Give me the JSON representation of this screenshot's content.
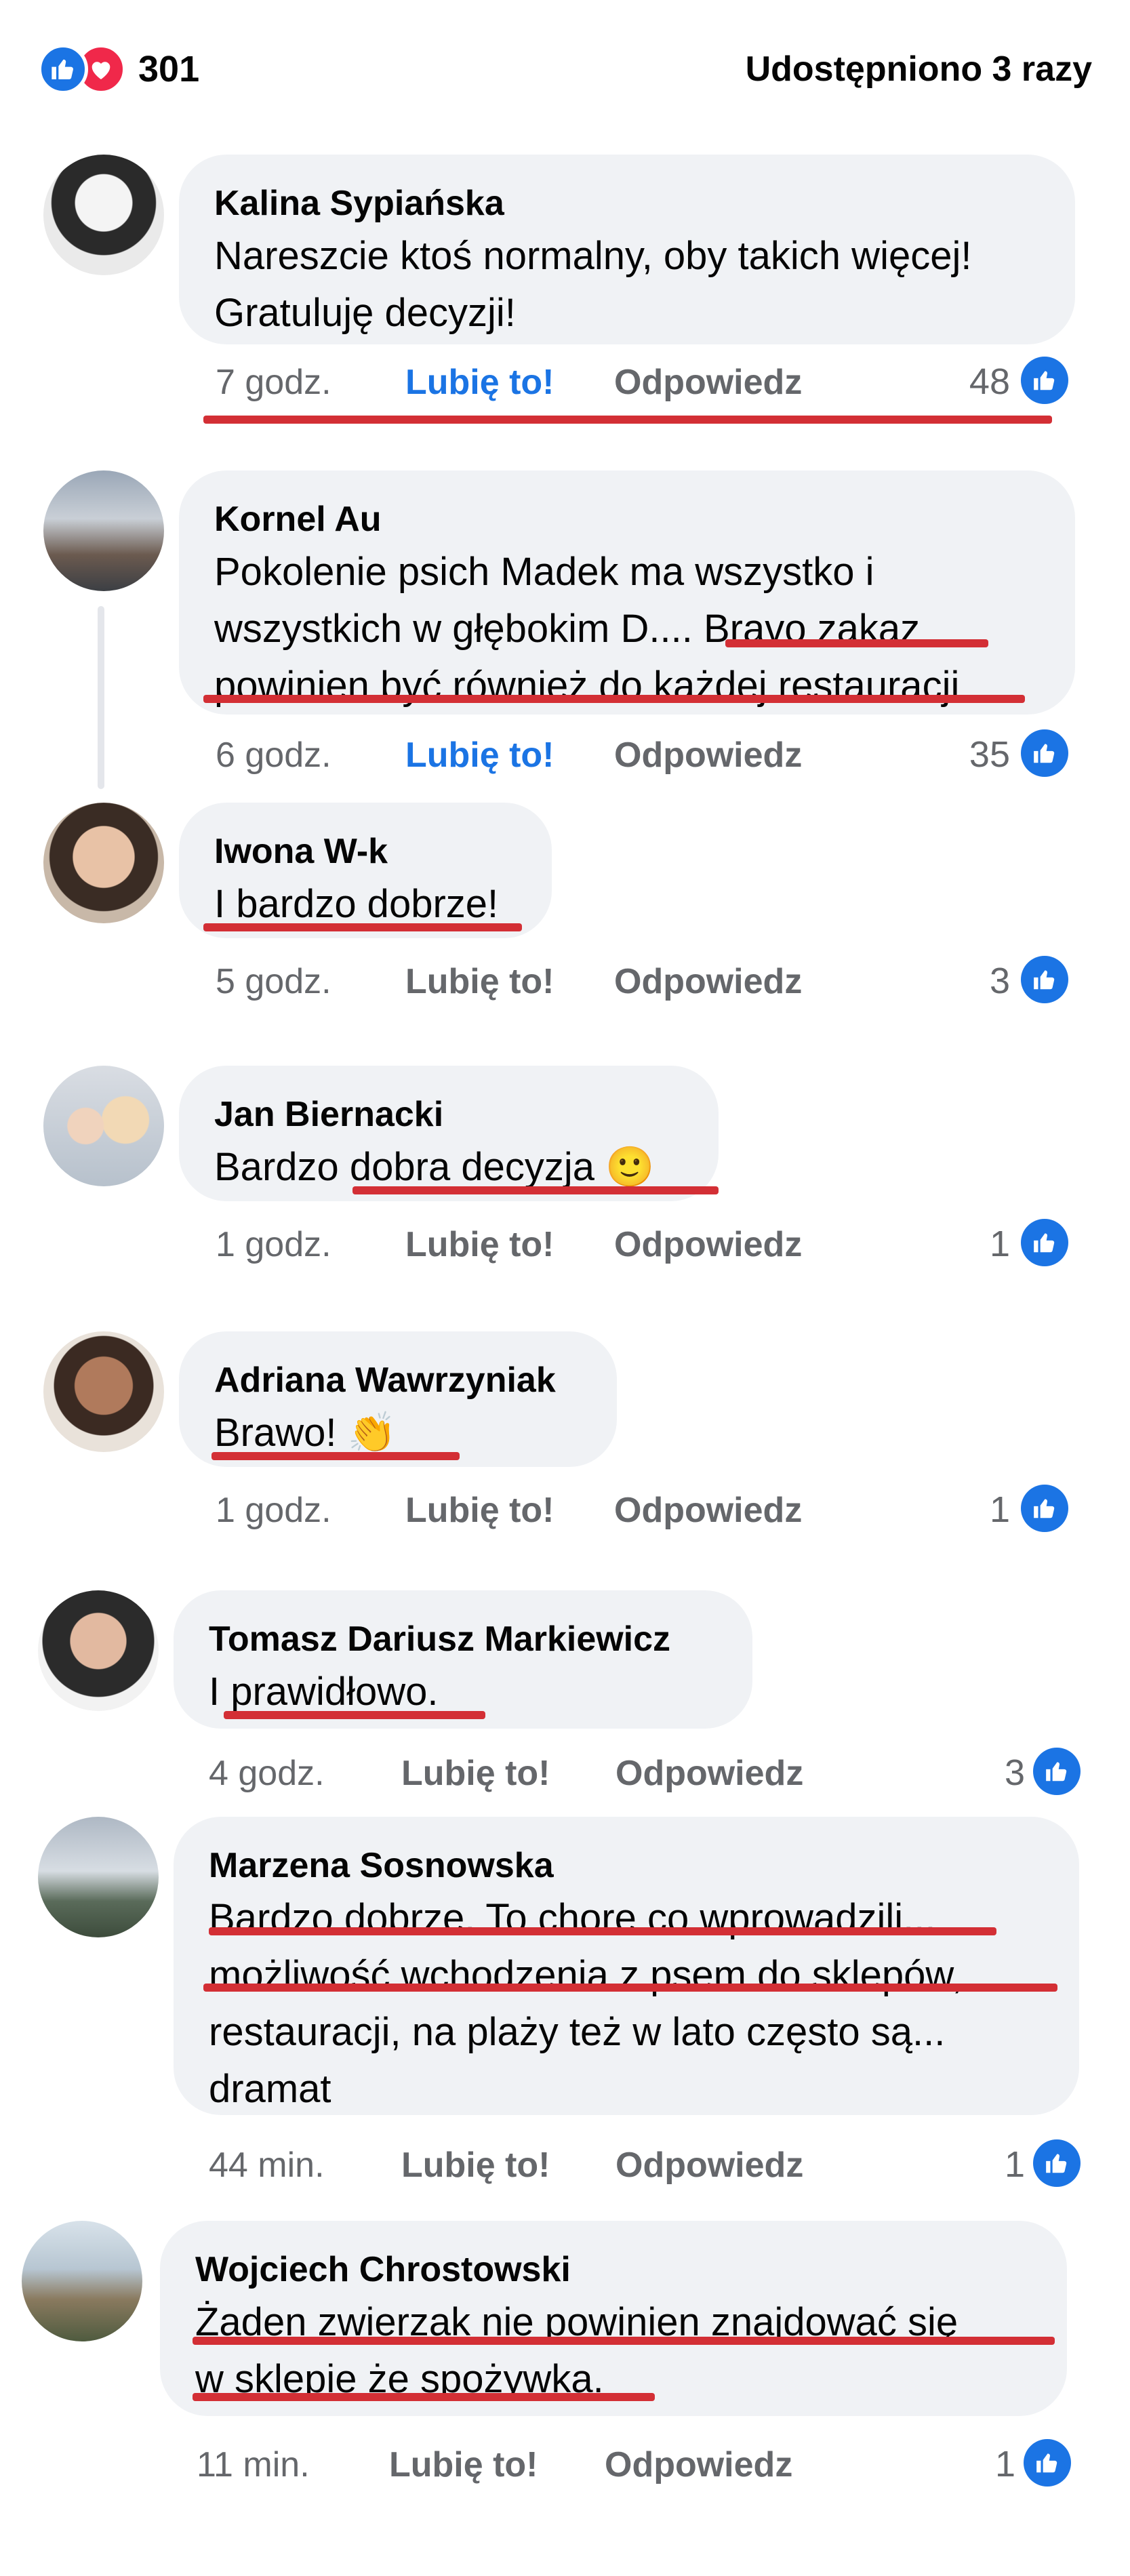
{
  "header": {
    "reaction_count": "301",
    "shares_label": "Udostępniono 3 razy"
  },
  "colors": {
    "like_blue": "#1b74e4",
    "love_red": "#f0284a",
    "bubble_bg": "#f0f2f5",
    "meta_gray": "#65676b",
    "annotation_red": "#d32f35"
  },
  "icons": {
    "like": "like-reaction-icon",
    "love": "love-reaction-icon",
    "thumb": "thumbs-up-icon"
  },
  "comments": [
    {
      "author": "Kalina Sypiańska",
      "lines": [
        "Nareszcie ktoś normalny, oby takich więcej!",
        "Gratuluję decyzji!"
      ],
      "time": "7 godz.",
      "like_label": "Lubię to!",
      "reply_label": "Odpowiedz",
      "likes": "48",
      "liked": true
    },
    {
      "author": "Kornel Au",
      "lines": [
        "Pokolenie psich Madek ma wszystko i",
        "wszystkich w głębokim D.... Bravo zakaz",
        "powinien być również do każdej restauracji"
      ],
      "time": "6 godz.",
      "like_label": "Lubię to!",
      "reply_label": "Odpowiedz",
      "likes": "35",
      "liked": true
    },
    {
      "author": "Iwona W-k",
      "lines": [
        "I bardzo dobrze!"
      ],
      "time": "5 godz.",
      "like_label": "Lubię to!",
      "reply_label": "Odpowiedz",
      "likes": "3",
      "liked": false
    },
    {
      "author": "Jan Biernacki",
      "lines": [
        "Bardzo dobra decyzja 🙂"
      ],
      "time": "1 godz.",
      "like_label": "Lubię to!",
      "reply_label": "Odpowiedz",
      "likes": "1",
      "liked": false
    },
    {
      "author": "Adriana Wawrzyniak",
      "lines": [
        "Brawo! 👏"
      ],
      "time": "1 godz.",
      "like_label": "Lubię to!",
      "reply_label": "Odpowiedz",
      "likes": "1",
      "liked": false
    },
    {
      "author": "Tomasz Dariusz Markiewicz",
      "lines": [
        "I prawidłowo."
      ],
      "time": "4 godz.",
      "like_label": "Lubię to!",
      "reply_label": "Odpowiedz",
      "likes": "3",
      "liked": false
    },
    {
      "author": "Marzena Sosnowska",
      "lines": [
        "Bardzo dobrze. To chore co wprowadzili...",
        "możliwość wchodzenia z psem do sklepów,",
        "restauracji, na plaży też w lato często są...",
        "dramat"
      ],
      "time": "44 min.",
      "like_label": "Lubię to!",
      "reply_label": "Odpowiedz",
      "likes": "1",
      "liked": false
    },
    {
      "author": "Wojciech Chrostowski",
      "lines": [
        "Żaden zwierzak nie powinien znajdować się",
        "w sklepie że spożywka."
      ],
      "time": "11 min.",
      "like_label": "Lubię to!",
      "reply_label": "Odpowiedz",
      "likes": "1",
      "liked": false
    }
  ]
}
